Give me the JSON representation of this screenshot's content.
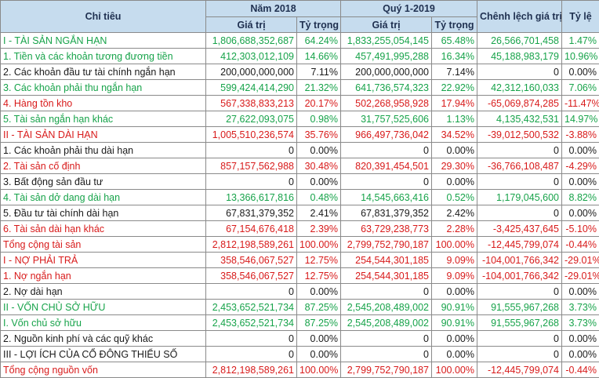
{
  "header": {
    "col_item": "Chỉ tiêu",
    "year2018": "Năm 2018",
    "q1_2019": "Quý 1-2019",
    "diff": "Chênh lệch giá trị",
    "ratio": "Tỷ lệ",
    "value": "Giá trị",
    "share": "Tỷ trọng"
  },
  "colors": {
    "green": "#17a34a",
    "red": "#d81b1b",
    "black": "#1a1a1a",
    "header_bg": "#c6dcee"
  },
  "rows": [
    {
      "label": "I - TÀI SẢN NGẮN HẠN",
      "v2018": "1,806,688,352,687",
      "s2018": "64.24%",
      "v2019": "1,833,255,054,145",
      "s2019": "65.48%",
      "diff": "26,566,701,458",
      "ratio": "1.47%",
      "color": "green",
      "indent": true
    },
    {
      "label": "1. Tiền và các khoản tương đương tiền",
      "v2018": "412,303,012,109",
      "s2018": "14.66%",
      "v2019": "457,491,995,288",
      "s2019": "16.34%",
      "diff": "45,188,983,179",
      "ratio": "10.96%",
      "color": "green",
      "indent": false
    },
    {
      "label": "2. Các khoản đầu tư tài chính ngắn hạn",
      "v2018": "200,000,000,000",
      "s2018": "7.11%",
      "v2019": "200,000,000,000",
      "s2019": "7.14%",
      "diff": "0",
      "ratio": "0.00%",
      "color": "black",
      "indent": false
    },
    {
      "label": "3. Các khoản phải thu ngắn hạn",
      "v2018": "599,424,414,290",
      "s2018": "21.32%",
      "v2019": "641,736,574,323",
      "s2019": "22.92%",
      "diff": "42,312,160,033",
      "ratio": "7.06%",
      "color": "green",
      "indent": false
    },
    {
      "label": "4. Hàng tồn kho",
      "v2018": "567,338,833,213",
      "s2018": "20.17%",
      "v2019": "502,268,958,928",
      "s2019": "17.94%",
      "diff": "-65,069,874,285",
      "ratio": "-11.47%",
      "color": "red",
      "indent": false
    },
    {
      "label": "5. Tài sản ngắn hạn khác",
      "v2018": "27,622,093,075",
      "s2018": "0.98%",
      "v2019": "31,757,525,606",
      "s2019": "1.13%",
      "diff": "4,135,432,531",
      "ratio": "14.97%",
      "color": "green",
      "indent": false
    },
    {
      "label": "II - TÀI SẢN DÀI HẠN",
      "v2018": "1,005,510,236,574",
      "s2018": "35.76%",
      "v2019": "966,497,736,042",
      "s2019": "34.52%",
      "diff": "-39,012,500,532",
      "ratio": "-3.88%",
      "color": "red",
      "indent": true
    },
    {
      "label": "1. Các khoản phải thu dài hạn",
      "v2018": "0",
      "s2018": "0.00%",
      "v2019": "0",
      "s2019": "0.00%",
      "diff": "0",
      "ratio": "0.00%",
      "color": "black",
      "indent": false
    },
    {
      "label": "2. Tài sản cố định",
      "v2018": "857,157,562,988",
      "s2018": "30.48%",
      "v2019": "820,391,454,501",
      "s2019": "29.30%",
      "diff": "-36,766,108,487",
      "ratio": "-4.29%",
      "color": "red",
      "indent": false
    },
    {
      "label": "3. Bất động sản đầu tư",
      "v2018": "0",
      "s2018": "0.00%",
      "v2019": "0",
      "s2019": "0.00%",
      "diff": "0",
      "ratio": "0.00%",
      "color": "black",
      "indent": false
    },
    {
      "label": "4. Tài sản dở dang dài hạn",
      "v2018": "13,366,617,816",
      "s2018": "0.48%",
      "v2019": "14,545,663,416",
      "s2019": "0.52%",
      "diff": "1,179,045,600",
      "ratio": "8.82%",
      "color": "green",
      "indent": false
    },
    {
      "label": "5. Đầu tư tài chính dài hạn",
      "v2018": "67,831,379,352",
      "s2018": "2.41%",
      "v2019": "67,831,379,352",
      "s2019": "2.42%",
      "diff": "0",
      "ratio": "0.00%",
      "color": "black",
      "indent": false
    },
    {
      "label": "6. Tài sản dài hạn khác",
      "v2018": "67,154,676,418",
      "s2018": "2.39%",
      "v2019": "63,729,238,773",
      "s2019": "2.28%",
      "diff": "-3,425,437,645",
      "ratio": "-5.10%",
      "color": "red",
      "indent": false
    },
    {
      "label": "Tổng cộng tài sản",
      "v2018": "2,812,198,589,261",
      "s2018": "100.00%",
      "v2019": "2,799,752,790,187",
      "s2019": "100.00%",
      "diff": "-12,445,799,074",
      "ratio": "-0.44%",
      "color": "red",
      "indent": true
    },
    {
      "label": "I - NỢ PHẢI TRẢ",
      "v2018": "358,546,067,527",
      "s2018": "12.75%",
      "v2019": "254,544,301,185",
      "s2019": "9.09%",
      "diff": "-104,001,766,342",
      "ratio": "-29.01%",
      "color": "red",
      "indent": true
    },
    {
      "label": "1. Nợ ngắn hạn",
      "v2018": "358,546,067,527",
      "s2018": "12.75%",
      "v2019": "254,544,301,185",
      "s2019": "9.09%",
      "diff": "-104,001,766,342",
      "ratio": "-29.01%",
      "color": "red",
      "indent": false
    },
    {
      "label": "2. Nợ dài hạn",
      "v2018": "0",
      "s2018": "0.00%",
      "v2019": "0",
      "s2019": "0.00%",
      "diff": "0",
      "ratio": "0.00%",
      "color": "black",
      "indent": false
    },
    {
      "label": "II - VỐN CHỦ SỞ HỮU",
      "v2018": "2,453,652,521,734",
      "s2018": "87.25%",
      "v2019": "2,545,208,489,002",
      "s2019": "90.91%",
      "diff": "91,555,967,268",
      "ratio": "3.73%",
      "color": "green",
      "indent": true
    },
    {
      "label": "I. Vốn chủ sở hữu",
      "v2018": "2,453,652,521,734",
      "s2018": "87.25%",
      "v2019": "2,545,208,489,002",
      "s2019": "90.91%",
      "diff": "91,555,967,268",
      "ratio": "3.73%",
      "color": "green",
      "indent": false
    },
    {
      "label": "2. Nguồn kinh phí và các quỹ khác",
      "v2018": "0",
      "s2018": "0.00%",
      "v2019": "0",
      "s2019": "0.00%",
      "diff": "0",
      "ratio": "0.00%",
      "color": "black",
      "indent": false
    },
    {
      "label": "III - LỢI ÍCH CỦA CỔ ĐÔNG THIỂU SỐ",
      "v2018": "0",
      "s2018": "0.00%",
      "v2019": "0",
      "s2019": "0.00%",
      "diff": "0",
      "ratio": "0.00%",
      "color": "black",
      "indent": true
    },
    {
      "label": "Tổng cộng nguồn vốn",
      "v2018": "2,812,198,589,261",
      "s2018": "100.00%",
      "v2019": "2,799,752,790,187",
      "s2019": "100.00%",
      "diff": "-12,445,799,074",
      "ratio": "-0.44%",
      "color": "red",
      "indent": true
    }
  ]
}
